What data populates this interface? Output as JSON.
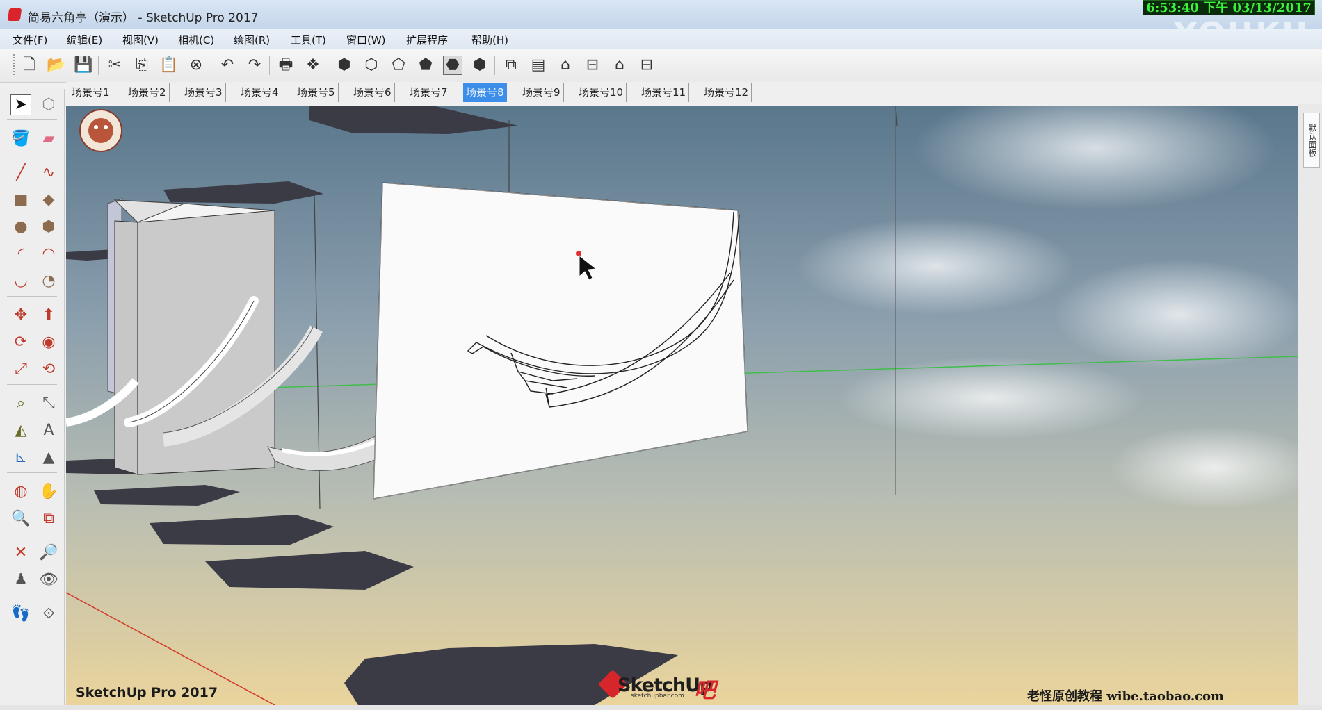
{
  "window": {
    "title": "简易六角亭（演示） - SketchUp Pro 2017",
    "clock": "6:53:40 下午 03/13/2017",
    "video_watermark": "YOUKU"
  },
  "menu": [
    {
      "id": "file",
      "label": "文件(F)"
    },
    {
      "id": "edit",
      "label": "编辑(E)"
    },
    {
      "id": "view",
      "label": "视图(V)"
    },
    {
      "id": "camera",
      "label": "相机(C)"
    },
    {
      "id": "draw",
      "label": "绘图(R)"
    },
    {
      "id": "tools",
      "label": "工具(T)"
    },
    {
      "id": "window",
      "label": "窗口(W)"
    },
    {
      "id": "extensions",
      "label": "扩展程序"
    },
    {
      "id": "help",
      "label": "帮助(H)"
    }
  ],
  "toolbar": [
    {
      "name": "new-icon",
      "glyph": "🗋"
    },
    {
      "name": "open-icon",
      "glyph": "📂"
    },
    {
      "name": "save-icon",
      "glyph": "💾"
    },
    {
      "name": "cut-icon",
      "glyph": "✂"
    },
    {
      "name": "copy-icon",
      "glyph": "⎘"
    },
    {
      "name": "paste-icon",
      "glyph": "📋"
    },
    {
      "name": "erase-selection-icon",
      "glyph": "⊗"
    },
    {
      "name": "undo-icon",
      "glyph": "↶"
    },
    {
      "name": "redo-icon",
      "glyph": "↷"
    },
    {
      "name": "print-icon",
      "glyph": "🖶"
    },
    {
      "name": "model-info-icon",
      "glyph": "❖"
    },
    {
      "name": "xray-style-icon",
      "glyph": "⬢"
    },
    {
      "name": "wireframe-style-icon",
      "glyph": "⬡"
    },
    {
      "name": "hidden-line-style-icon",
      "glyph": "⬠"
    },
    {
      "name": "shaded-style-icon",
      "glyph": "⬟"
    },
    {
      "name": "shaded-texture-style-icon",
      "glyph": "⬣"
    },
    {
      "name": "monochrome-style-icon",
      "glyph": "⬢"
    },
    {
      "name": "iso-view-icon",
      "glyph": "⧉"
    },
    {
      "name": "top-view-icon",
      "glyph": "▤"
    },
    {
      "name": "front-view-icon",
      "glyph": "⌂"
    },
    {
      "name": "right-view-icon",
      "glyph": "⊟"
    },
    {
      "name": "back-view-icon",
      "glyph": "⌂"
    },
    {
      "name": "left-view-icon",
      "glyph": "⊟"
    }
  ],
  "scenes": {
    "active_index": 7,
    "tabs": [
      "场景号1",
      "场景号2",
      "场景号3",
      "场景号4",
      "场景号5",
      "场景号6",
      "场景号7",
      "场景号8",
      "场景号9",
      "场景号10",
      "场景号11",
      "场景号12"
    ]
  },
  "left_tools": [
    {
      "name": "select-tool-icon",
      "glyph": "➤",
      "color": "#111111",
      "selected": true
    },
    {
      "name": "make-component-icon",
      "glyph": "⬡",
      "color": "#8a8a8a"
    },
    {
      "name": "paint-bucket-icon",
      "glyph": "🪣",
      "color": "#c89a2a"
    },
    {
      "name": "eraser-icon",
      "glyph": "▰",
      "color": "#e06a84"
    },
    {
      "name": "line-tool-icon",
      "glyph": "╱",
      "color": "#c0392b"
    },
    {
      "name": "freehand-tool-icon",
      "glyph": "∿",
      "color": "#c0392b"
    },
    {
      "name": "rectangle-tool-icon",
      "glyph": "■",
      "color": "#8c6b4e"
    },
    {
      "name": "rotated-rectangle-icon",
      "glyph": "◆",
      "color": "#8c6b4e"
    },
    {
      "name": "circle-tool-icon",
      "glyph": "●",
      "color": "#8c6b4e"
    },
    {
      "name": "polygon-tool-icon",
      "glyph": "⬢",
      "color": "#8c6b4e"
    },
    {
      "name": "arc-tool-icon",
      "glyph": "◜",
      "color": "#c0392b"
    },
    {
      "name": "two-point-arc-icon",
      "glyph": "◠",
      "color": "#c0392b"
    },
    {
      "name": "three-point-arc-icon",
      "glyph": "◡",
      "color": "#c0392b"
    },
    {
      "name": "pie-tool-icon",
      "glyph": "◔",
      "color": "#8c6b4e"
    },
    {
      "name": "move-tool-icon",
      "glyph": "✥",
      "color": "#c0392b"
    },
    {
      "name": "push-pull-icon",
      "glyph": "⬆",
      "color": "#c0392b"
    },
    {
      "name": "rotate-tool-icon",
      "glyph": "⟳",
      "color": "#c0392b"
    },
    {
      "name": "follow-me-icon",
      "glyph": "◉",
      "color": "#c0392b"
    },
    {
      "name": "scale-tool-icon",
      "glyph": "⤢",
      "color": "#c0392b"
    },
    {
      "name": "offset-tool-icon",
      "glyph": "⟲",
      "color": "#c0392b"
    },
    {
      "name": "tape-measure-icon",
      "glyph": "⌕",
      "color": "#6b6b2a"
    },
    {
      "name": "dimension-tool-icon",
      "glyph": "⤡",
      "color": "#555555"
    },
    {
      "name": "protractor-icon",
      "glyph": "◭",
      "color": "#6b6b2a"
    },
    {
      "name": "text-tool-icon",
      "glyph": "A",
      "color": "#555555"
    },
    {
      "name": "axes-tool-icon",
      "glyph": "⊾",
      "color": "#2a6bc0"
    },
    {
      "name": "3d-text-icon",
      "glyph": "▲",
      "color": "#555555"
    },
    {
      "name": "orbit-tool-icon",
      "glyph": "◍",
      "color": "#c0392b"
    },
    {
      "name": "pan-tool-icon",
      "glyph": "✋",
      "color": "#c89a2a"
    },
    {
      "name": "zoom-tool-icon",
      "glyph": "🔍",
      "color": "#2a6bc0"
    },
    {
      "name": "zoom-window-icon",
      "glyph": "⧉",
      "color": "#c0392b"
    },
    {
      "name": "zoom-extents-icon",
      "glyph": "✕",
      "color": "#c0392b"
    },
    {
      "name": "previous-view-icon",
      "glyph": "🔎",
      "color": "#2a6bc0"
    },
    {
      "name": "position-camera-icon",
      "glyph": "♟",
      "color": "#555555"
    },
    {
      "name": "look-around-icon",
      "glyph": "👁",
      "color": "#555555"
    },
    {
      "name": "walk-tool-icon",
      "glyph": "👣",
      "color": "#333333"
    },
    {
      "name": "section-plane-icon",
      "glyph": "⟐",
      "color": "#555555"
    }
  ],
  "viewport": {
    "label_left": "SketchUp Pro 2017",
    "label_right": "老怪原创教程  wibe.taobao.com",
    "logo_text": "SketchUp",
    "logo_sub": "sketchupbar.com",
    "logo_suffix": "吧",
    "axis_green": "#3fbf4a",
    "axis_red": "#d23a2a",
    "shadow_color": "#3b3b45"
  },
  "right_panel": {
    "tab_label": "默认面板"
  }
}
